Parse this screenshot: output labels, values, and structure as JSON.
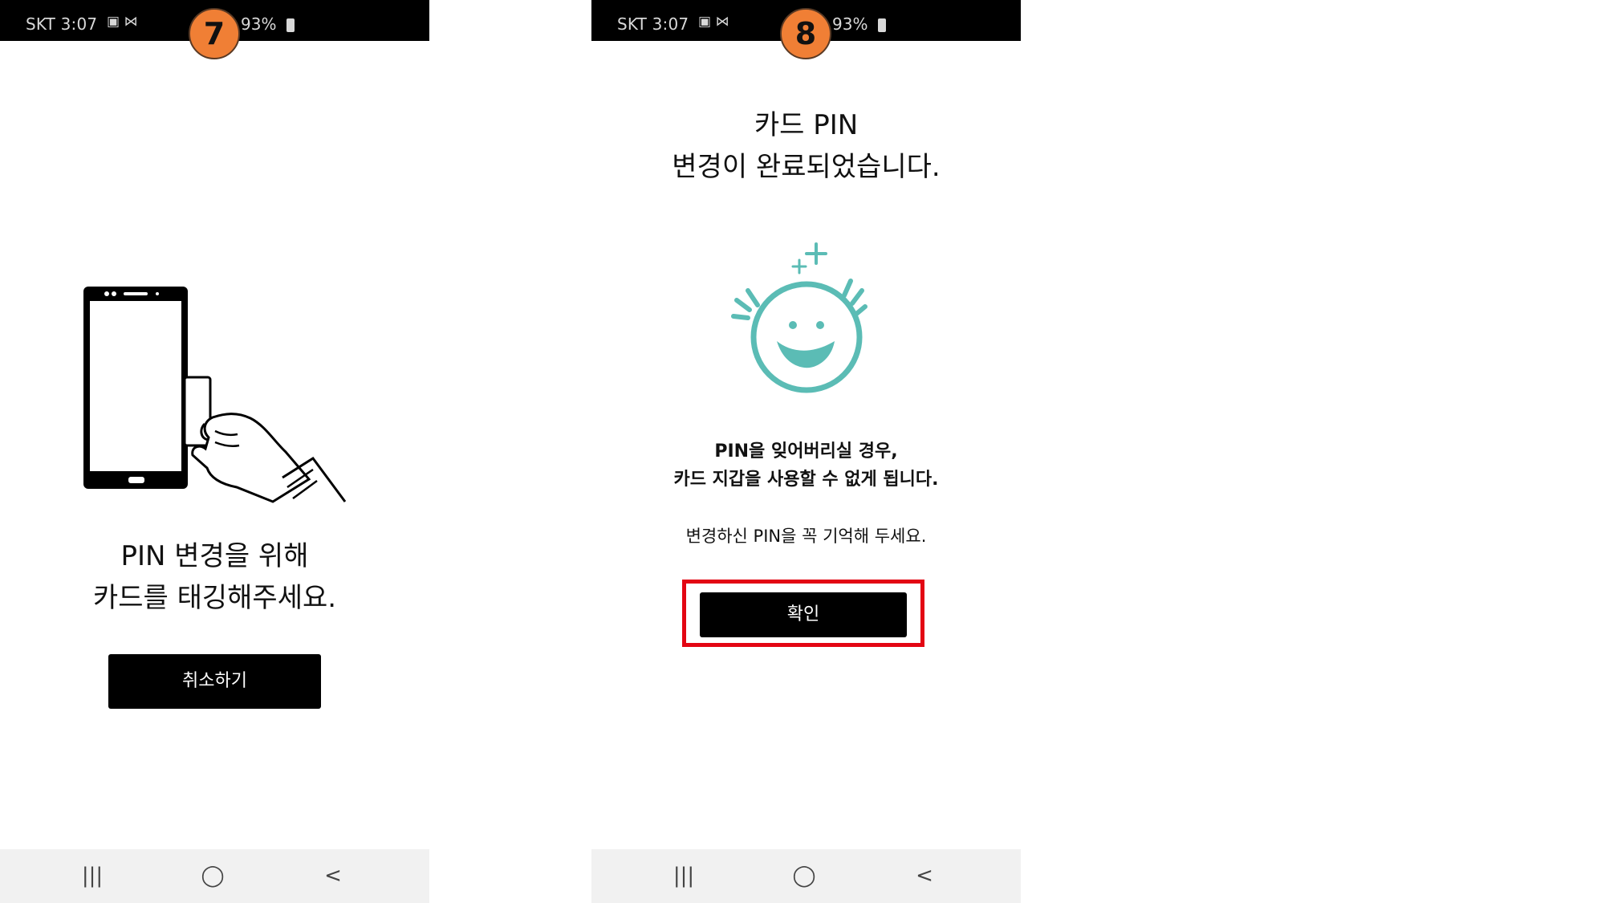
{
  "status_bar": {
    "carrier_time": "SKT 3:07",
    "notification_icons": "▣ ⋈",
    "battery": "93%"
  },
  "screens": [
    {
      "step": "7",
      "title_lines": [
        "PIN 변경을 위해",
        "카드를 태깅해주세요."
      ],
      "button_label": "취소하기"
    },
    {
      "step": "8",
      "title_lines": [
        "카드 PIN",
        "변경이 완료되었습니다."
      ],
      "warning_lines": [
        "PIN을 잊어버리실 경우,",
        "카드 지갑을 사용할 수 없게 됩니다."
      ],
      "note": "변경하신 PIN을 꼭 기억해 두세요.",
      "button_label": "확인"
    }
  ],
  "navigation": {
    "recent": "|||",
    "home": "◯",
    "back": "<"
  },
  "icons": {
    "screen_1_illustration": "phone-tag-card-illustration",
    "screen_2_illustration": "smiley-face-illustration"
  },
  "colors": {
    "step_badge": "#f07f35",
    "highlight": "#e30613",
    "smiley": "#5bbcb5"
  }
}
